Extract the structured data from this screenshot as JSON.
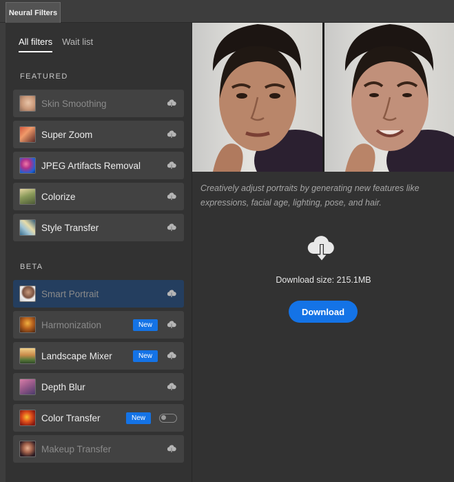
{
  "window": {
    "tab_title": "Neural Filters"
  },
  "subtabs": {
    "all": "All filters",
    "wait": "Wait list"
  },
  "sections": {
    "featured": "FEATURED",
    "beta": "BETA"
  },
  "featured": [
    {
      "label": "Skin Smoothing",
      "icon": "skin-smoothing-thumb",
      "state": "disabled"
    },
    {
      "label": "Super Zoom",
      "icon": "super-zoom-thumb",
      "state": "normal"
    },
    {
      "label": "JPEG Artifacts Removal",
      "icon": "jpeg-artifacts-thumb",
      "state": "normal"
    },
    {
      "label": "Colorize",
      "icon": "colorize-thumb",
      "state": "normal"
    },
    {
      "label": "Style Transfer",
      "icon": "style-transfer-thumb",
      "state": "normal"
    }
  ],
  "beta": [
    {
      "label": "Smart Portrait",
      "icon": "smart-portrait-thumb",
      "state": "selected"
    },
    {
      "label": "Harmonization",
      "icon": "harmonization-thumb",
      "state": "disabled",
      "badge": "New"
    },
    {
      "label": "Landscape Mixer",
      "icon": "landscape-mixer-thumb",
      "state": "normal",
      "badge": "New"
    },
    {
      "label": "Depth Blur",
      "icon": "depth-blur-thumb",
      "state": "normal"
    },
    {
      "label": "Color Transfer",
      "icon": "color-transfer-thumb",
      "state": "normal",
      "badge": "New",
      "toggle": "off"
    },
    {
      "label": "Makeup Transfer",
      "icon": "makeup-transfer-thumb",
      "state": "disabled"
    }
  ],
  "detail": {
    "description": "Creatively adjust portraits by generating new features like expressions, facial age, lighting, pose, and hair.",
    "download_size": "Download size: 215.1MB",
    "download_label": "Download"
  },
  "colors": {
    "accent": "#1473e6",
    "selected": "#243e5f",
    "panel": "#323232",
    "item": "#424242"
  }
}
